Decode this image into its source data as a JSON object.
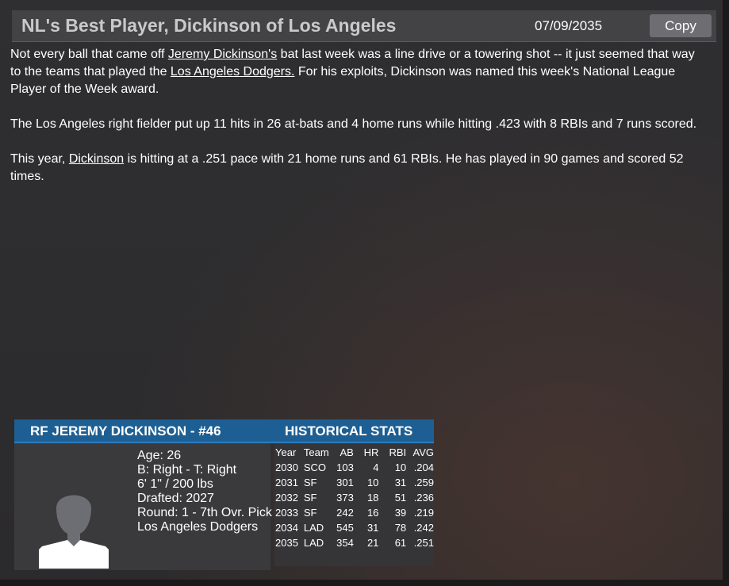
{
  "header": {
    "title": "NL's Best Player, Dickinson of Los Angeles",
    "date": "07/09/2035",
    "copy_label": "Copy"
  },
  "article": {
    "p1": {
      "t1": "Not every ball that came off ",
      "link1": "Jeremy Dickinson's",
      "t2": " bat last week was a line drive or a towering shot -- it just seemed that way to the teams that played the ",
      "link2": "Los Angeles Dodgers.",
      "t3": " For his exploits, Dickinson was named this week's National League Player of the Week award."
    },
    "p2": "The Los Angeles right fielder put up 11 hits in 26 at-bats and 4 home runs while hitting .423 with 8 RBIs and 7 runs scored.",
    "p3": {
      "t1": "This year, ",
      "link1": "Dickinson",
      "t2": " is hitting at a .251 pace with 21 home runs and 61 RBIs. He has played in 90 games and scored 52 times."
    }
  },
  "player_card": {
    "name": "RF JEREMY DICKINSON - #46",
    "historical_label": "HISTORICAL STATS",
    "age": "Age: 26",
    "bats_throws": "B: Right - T: Right",
    "height_weight": "6' 1\" / 200 lbs",
    "drafted": "Drafted: 2027",
    "round": "Round: 1 - 7th Ovr. Pick",
    "team": "Los Angeles Dodgers",
    "stats_headers": [
      "Year",
      "Team",
      "AB",
      "HR",
      "RBI",
      "AVG"
    ],
    "stats_rows": [
      [
        "2030",
        "SCO",
        "103",
        "4",
        "10",
        ".204"
      ],
      [
        "2031",
        "SF",
        "301",
        "10",
        "31",
        ".259"
      ],
      [
        "2032",
        "SF",
        "373",
        "18",
        "51",
        ".236"
      ],
      [
        "2033",
        "SF",
        "242",
        "16",
        "39",
        ".219"
      ],
      [
        "2034",
        "LAD",
        "545",
        "31",
        "78",
        ".242"
      ],
      [
        "2035",
        "LAD",
        "354",
        "21",
        "61",
        ".251"
      ]
    ]
  },
  "colors": {
    "background": "#2d2d2f",
    "header_bar": "#434345",
    "card_header": "#1e5f93",
    "copy_button": "#6e6e72"
  },
  "icons": {
    "avatar": "person-silhouette-icon"
  }
}
